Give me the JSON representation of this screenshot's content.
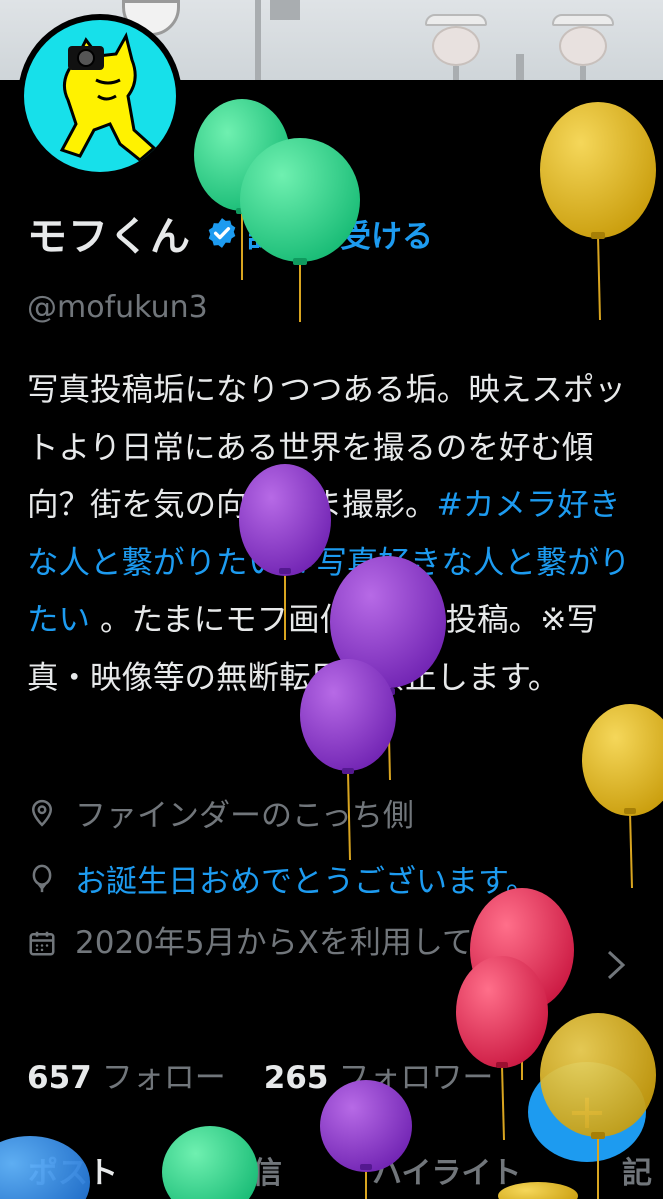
{
  "profile": {
    "name": "モフくん",
    "verify_link": "認証を受ける",
    "handle": "@mofukun3",
    "bio_parts": [
      "写真投稿垢になりつつある垢。映えスポットより日常にある世界を撮るのを好む傾向？街を気の向くまま撮影。",
      "#カメラ好きな人と繋がりたい",
      " ",
      "#写真好きな人と繋がりたい",
      " 。たまにモフ画伯の絵も投稿。※写真・映像等の無断転用を禁止します。"
    ],
    "location": "ファインダーのこっち側",
    "birthday": "お誕生日おめでとうございます。",
    "joined": "2020年5月からXを利用しています"
  },
  "stats": {
    "following_count": "657",
    "following_label": "フォロー",
    "followers_count": "265",
    "followers_label": "フォロワー"
  },
  "tabs": [
    "ポスト",
    "返信",
    "ハイライト",
    "記"
  ],
  "fab": {
    "label": "+"
  },
  "icons": {
    "location": "location-pin-icon",
    "birthday": "balloon-icon",
    "joined": "calendar-icon",
    "joined_more": "chevron-right-icon",
    "verified": "verified-badge-icon"
  },
  "colors": {
    "accent": "#1d9bf0",
    "background": "#000000",
    "text": "#e7e9ea",
    "muted": "#71767b"
  }
}
